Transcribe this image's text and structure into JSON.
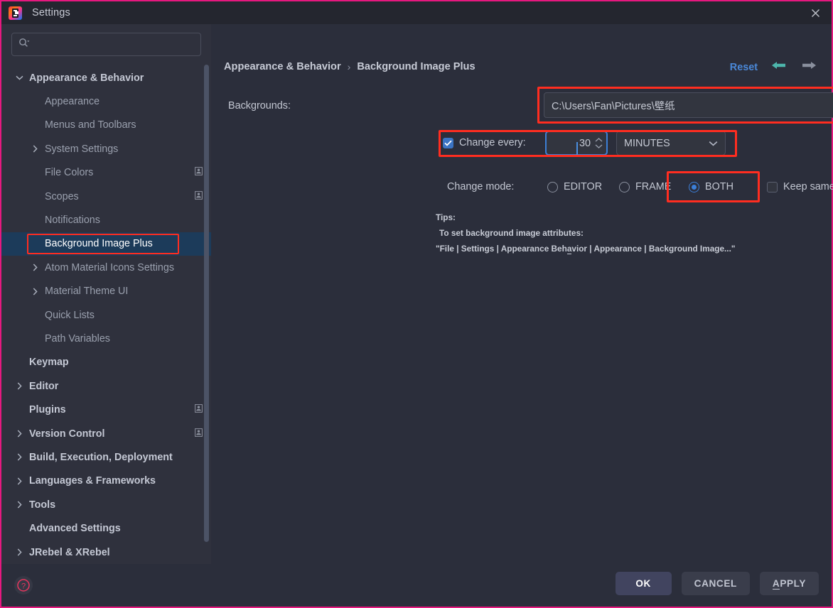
{
  "window": {
    "title": "Settings",
    "logo_icon": "intellij-idea-logo",
    "close_icon": "close-icon",
    "border_color": "#e6187f"
  },
  "search": {
    "icon": "search-icon",
    "value": "",
    "placeholder": ""
  },
  "sidebar": {
    "items": [
      {
        "label": "Appearance & Behavior",
        "indent": 0,
        "arrow": "down",
        "bold": true,
        "selected": false,
        "badge": false
      },
      {
        "label": "Appearance",
        "indent": 1,
        "arrow": "none",
        "bold": false,
        "selected": false,
        "badge": false
      },
      {
        "label": "Menus and Toolbars",
        "indent": 1,
        "arrow": "none",
        "bold": false,
        "selected": false,
        "badge": false
      },
      {
        "label": "System Settings",
        "indent": 1,
        "arrow": "right",
        "bold": false,
        "selected": false,
        "badge": false
      },
      {
        "label": "File Colors",
        "indent": 1,
        "arrow": "none",
        "bold": false,
        "selected": false,
        "badge": true
      },
      {
        "label": "Scopes",
        "indent": 1,
        "arrow": "none",
        "bold": false,
        "selected": false,
        "badge": true
      },
      {
        "label": "Notifications",
        "indent": 1,
        "arrow": "none",
        "bold": false,
        "selected": false,
        "badge": false
      },
      {
        "label": "Background Image Plus",
        "indent": 1,
        "arrow": "none",
        "bold": false,
        "selected": true,
        "badge": false
      },
      {
        "label": "Atom Material Icons Settings",
        "indent": 1,
        "arrow": "right",
        "bold": false,
        "selected": false,
        "badge": false
      },
      {
        "label": "Material Theme UI",
        "indent": 1,
        "arrow": "right",
        "bold": false,
        "selected": false,
        "badge": false
      },
      {
        "label": "Quick Lists",
        "indent": 1,
        "arrow": "none",
        "bold": false,
        "selected": false,
        "badge": false
      },
      {
        "label": "Path Variables",
        "indent": 1,
        "arrow": "none",
        "bold": false,
        "selected": false,
        "badge": false
      },
      {
        "label": "Keymap",
        "indent": 0,
        "arrow": "none",
        "bold": true,
        "selected": false,
        "badge": false
      },
      {
        "label": "Editor",
        "indent": 0,
        "arrow": "right",
        "bold": true,
        "selected": false,
        "badge": false
      },
      {
        "label": "Plugins",
        "indent": 0,
        "arrow": "none",
        "bold": true,
        "selected": false,
        "badge": true
      },
      {
        "label": "Version Control",
        "indent": 0,
        "arrow": "right",
        "bold": true,
        "selected": false,
        "badge": true
      },
      {
        "label": "Build, Execution, Deployment",
        "indent": 0,
        "arrow": "right",
        "bold": true,
        "selected": false,
        "badge": false
      },
      {
        "label": "Languages & Frameworks",
        "indent": 0,
        "arrow": "right",
        "bold": true,
        "selected": false,
        "badge": false
      },
      {
        "label": "Tools",
        "indent": 0,
        "arrow": "right",
        "bold": true,
        "selected": false,
        "badge": false
      },
      {
        "label": "Advanced Settings",
        "indent": 0,
        "arrow": "none",
        "bold": true,
        "selected": false,
        "badge": false
      },
      {
        "label": "JRebel & XRebel",
        "indent": 0,
        "arrow": "right",
        "bold": true,
        "selected": false,
        "badge": false
      }
    ]
  },
  "breadcrumb": {
    "root": "Appearance & Behavior",
    "separator": "›",
    "current": "Background Image Plus"
  },
  "topright": {
    "reset_label": "Reset",
    "back_icon": "arrow-left-icon",
    "forward_icon": "arrow-right-icon",
    "reset_color": "#4a88d8",
    "back_color": "#4db6ac",
    "forward_color": "#8a909e"
  },
  "form": {
    "backgrounds_label": "Backgrounds:",
    "backgrounds_value": "C:\\Users\\Fan\\Pictures\\壁纸",
    "browse_icon": "folder-icon",
    "change_every_label": "Change every:",
    "change_every_checked": true,
    "interval_value": "30",
    "unit_value": "MINUTES",
    "unit_caret_icon": "chevron-down-icon",
    "change_mode_label": "Change mode:",
    "modes": [
      {
        "label": "EDITOR",
        "selected": false
      },
      {
        "label": "FRAME",
        "selected": false
      },
      {
        "label": "BOTH",
        "selected": true
      }
    ],
    "keep_same_image_label": "Keep same image",
    "keep_same_image_checked": false
  },
  "tips": {
    "title": "Tips:",
    "line2": "To set background image attributes:",
    "line3_prefix": "\"File | Settings | Appearance  Beh",
    "line3_underlined": "a",
    "line3_suffix": "vior | Appearance | Background Image...\""
  },
  "footer": {
    "help_icon": "help-icon",
    "ok_label": "OK",
    "cancel_label": "CANCEL",
    "apply_underlined": "A",
    "apply_rest": "PPLY"
  },
  "annotations": {
    "highlight_color": "#ff2d20"
  }
}
